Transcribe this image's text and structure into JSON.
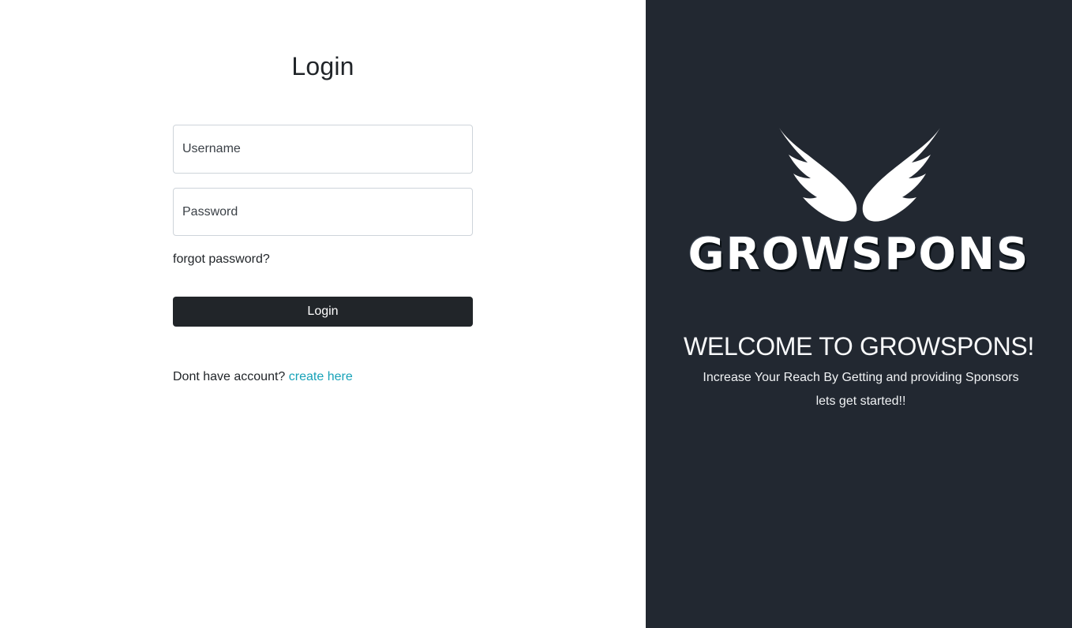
{
  "login": {
    "title": "Login",
    "username_placeholder": "Username",
    "password_placeholder": "Password",
    "forgot_label": "forgot password?",
    "submit_label": "Login",
    "signup_prompt": "Dont have account?",
    "signup_link": "create here"
  },
  "brand": {
    "logo_icon": "wings-icon",
    "wordmark": "GROWSPONS",
    "welcome": "WELCOME TO GROWSPONS!",
    "tagline": "Increase Your Reach By Getting and providing Sponsors",
    "subtagline": "lets get started!!"
  },
  "colors": {
    "panel_bg": "#222831",
    "button_bg": "#212529",
    "link": "#17a2b8"
  }
}
